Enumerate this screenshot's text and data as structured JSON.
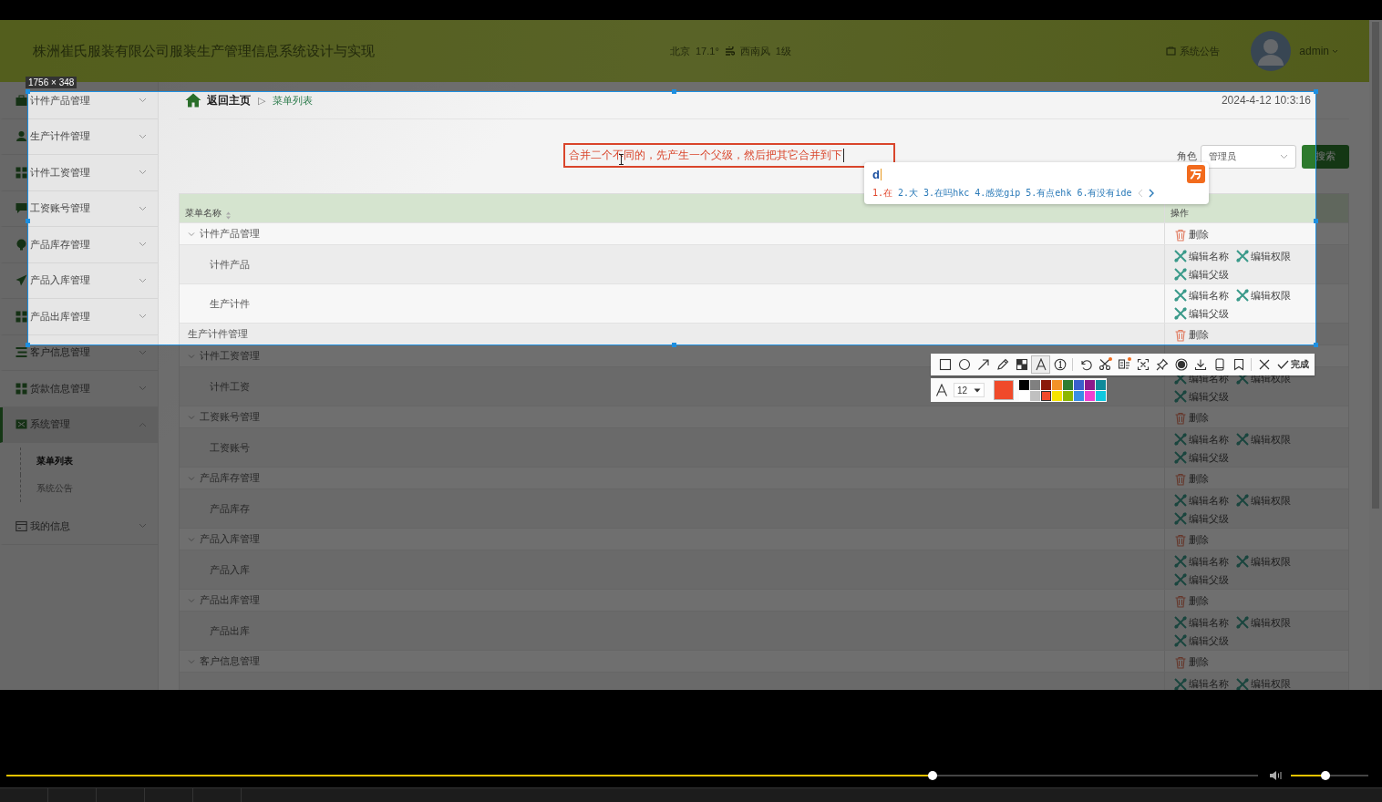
{
  "header": {
    "title": "株洲崔氏服装有限公司服装生产管理信息系统设计与实现",
    "weather": {
      "city": "北京",
      "temperature": "17.1°",
      "wind": "西南风",
      "wind_force": "1级"
    },
    "notice_link": "系统公告",
    "user": "admin"
  },
  "sidebar": {
    "items": [
      {
        "label": "计件产品管理",
        "expanded": false,
        "selected": false
      },
      {
        "label": "生产计件管理",
        "expanded": false,
        "selected": false
      },
      {
        "label": "计件工资管理",
        "expanded": false,
        "selected": false
      },
      {
        "label": "工资账号管理",
        "expanded": false,
        "selected": false
      },
      {
        "label": "产品库存管理",
        "expanded": false,
        "selected": false
      },
      {
        "label": "产品入库管理",
        "expanded": false,
        "selected": false
      },
      {
        "label": "产品出库管理",
        "expanded": false,
        "selected": false
      },
      {
        "label": "客户信息管理",
        "expanded": false,
        "selected": false
      },
      {
        "label": "货款信息管理",
        "expanded": false,
        "selected": false
      },
      {
        "label": "系统管理",
        "expanded": true,
        "selected": true,
        "children": [
          {
            "label": "菜单列表",
            "selected": true
          },
          {
            "label": "系统公告",
            "selected": false
          }
        ]
      },
      {
        "label": "我的信息",
        "expanded": false,
        "selected": false
      }
    ]
  },
  "breadcrumb": {
    "home": "返回主页",
    "separator": "▷",
    "current": "菜单列表"
  },
  "datetime": "2024-4-12 10:3:16",
  "search": {
    "role_label": "角色",
    "role_value": "管理员",
    "button": "搜索"
  },
  "table": {
    "columns": [
      {
        "label": "菜单名称",
        "sortable": true
      },
      {
        "label": "操作",
        "sortable": false
      }
    ],
    "rows": [
      {
        "name": "计件产品管理",
        "expanded": true,
        "ops": [
          {
            "kind": "delete",
            "label": "删除"
          }
        ],
        "children": [
          {
            "name": "计件产品",
            "ops": [
              {
                "kind": "edit",
                "label": "编辑名称"
              },
              {
                "kind": "edit",
                "label": "编辑权限"
              },
              {
                "kind": "edit",
                "label": "编辑父级"
              }
            ]
          },
          {
            "name": "生产计件",
            "ops": [
              {
                "kind": "edit",
                "label": "编辑名称"
              },
              {
                "kind": "edit",
                "label": "编辑权限"
              },
              {
                "kind": "edit",
                "label": "编辑父级"
              }
            ]
          }
        ]
      },
      {
        "name": "生产计件管理",
        "ops": [
          {
            "kind": "delete",
            "label": "删除"
          }
        ]
      },
      {
        "name": "计件工资管理",
        "expanded": true,
        "children": [
          {
            "name": "计件工资",
            "ops": [
              {
                "kind": "edit",
                "label": "编辑名称"
              },
              {
                "kind": "edit",
                "label": "编辑权限"
              },
              {
                "kind": "edit",
                "label": "编辑父级"
              }
            ]
          }
        ]
      },
      {
        "name": "工资账号管理",
        "expanded": true,
        "ops": [
          {
            "kind": "delete",
            "label": "删除"
          }
        ],
        "children": [
          {
            "name": "工资账号",
            "ops": [
              {
                "kind": "edit",
                "label": "编辑名称"
              },
              {
                "kind": "edit",
                "label": "编辑权限"
              },
              {
                "kind": "edit",
                "label": "编辑父级"
              }
            ]
          }
        ]
      },
      {
        "name": "产品库存管理",
        "expanded": true,
        "ops": [
          {
            "kind": "delete",
            "label": "删除"
          }
        ],
        "children": [
          {
            "name": "产品库存",
            "ops": [
              {
                "kind": "edit",
                "label": "编辑名称"
              },
              {
                "kind": "edit",
                "label": "编辑权限"
              },
              {
                "kind": "edit",
                "label": "编辑父级"
              }
            ]
          }
        ]
      },
      {
        "name": "产品入库管理",
        "expanded": true,
        "ops": [
          {
            "kind": "delete",
            "label": "删除"
          }
        ],
        "children": [
          {
            "name": "产品入库",
            "ops": [
              {
                "kind": "edit",
                "label": "编辑名称"
              },
              {
                "kind": "edit",
                "label": "编辑权限"
              },
              {
                "kind": "edit",
                "label": "编辑父级"
              }
            ]
          }
        ]
      },
      {
        "name": "产品出库管理",
        "expanded": true,
        "ops": [
          {
            "kind": "delete",
            "label": "删除"
          }
        ],
        "children": [
          {
            "name": "产品出库",
            "ops": [
              {
                "kind": "edit",
                "label": "编辑名称"
              },
              {
                "kind": "edit",
                "label": "编辑权限"
              },
              {
                "kind": "edit",
                "label": "编辑父级"
              }
            ]
          }
        ]
      },
      {
        "name": "客户信息管理",
        "expanded": true,
        "ops": [
          {
            "kind": "delete",
            "label": "删除"
          }
        ],
        "children": [
          {
            "ops": [
              {
                "kind": "edit",
                "label": "编辑名称"
              },
              {
                "kind": "edit",
                "label": "编辑权限"
              }
            ]
          }
        ]
      }
    ]
  },
  "annotation": {
    "text": "合并二个不同的，先产生一个父级，然后把其它合并到下"
  },
  "ime": {
    "input": "d",
    "candidates": [
      {
        "text": "1.在",
        "selected": true
      },
      {
        "text": "2.大",
        "selected": false
      },
      {
        "text": "3.在吗hkc",
        "selected": false
      },
      {
        "text": "4.感觉gip",
        "selected": false
      },
      {
        "text": "5.有点ehk",
        "selected": false
      },
      {
        "text": "6.有没有ide",
        "selected": false
      }
    ]
  },
  "screenshot_tool": {
    "size_label": "1756 × 348",
    "tools": [
      {
        "selected": false
      },
      {
        "selected": false
      },
      {
        "selected": false
      },
      {
        "selected": false
      },
      {
        "selected": false
      },
      {
        "selected": true
      },
      {
        "selected": false
      },
      {
        "selected": false
      },
      {
        "selected": false
      },
      {
        "selected": false
      },
      {
        "selected": false
      },
      {
        "selected": false
      },
      {
        "selected": false
      },
      {
        "selected": false
      },
      {
        "selected": false
      },
      {
        "selected": false
      }
    ],
    "done": "完成",
    "font_size": "12",
    "palette": [
      {
        "color": "#000000",
        "selected": false
      },
      {
        "color": "#808080",
        "selected": false
      },
      {
        "color": "#8b1a0a",
        "selected": false
      },
      {
        "color": "#f39228",
        "selected": false
      },
      {
        "color": "#2e7d32",
        "selected": false
      },
      {
        "color": "#3a5fcd",
        "selected": false
      },
      {
        "color": "#8b1a8b",
        "selected": false
      },
      {
        "color": "#0e8a9a",
        "selected": false
      },
      {
        "color": "#ffffff",
        "selected": false
      },
      {
        "color": "#c0c0c0",
        "selected": false
      },
      {
        "color": "#f04a2a",
        "selected": true
      },
      {
        "color": "#f5e400",
        "selected": false
      },
      {
        "color": "#8db600",
        "selected": false
      },
      {
        "color": "#3a8ee6",
        "selected": false
      },
      {
        "color": "#f040d0",
        "selected": false
      },
      {
        "color": "#10c8e0",
        "selected": false
      }
    ]
  },
  "player": {
    "progress": {
      "level": 0.74
    },
    "volume": {
      "level": 0.45
    }
  }
}
